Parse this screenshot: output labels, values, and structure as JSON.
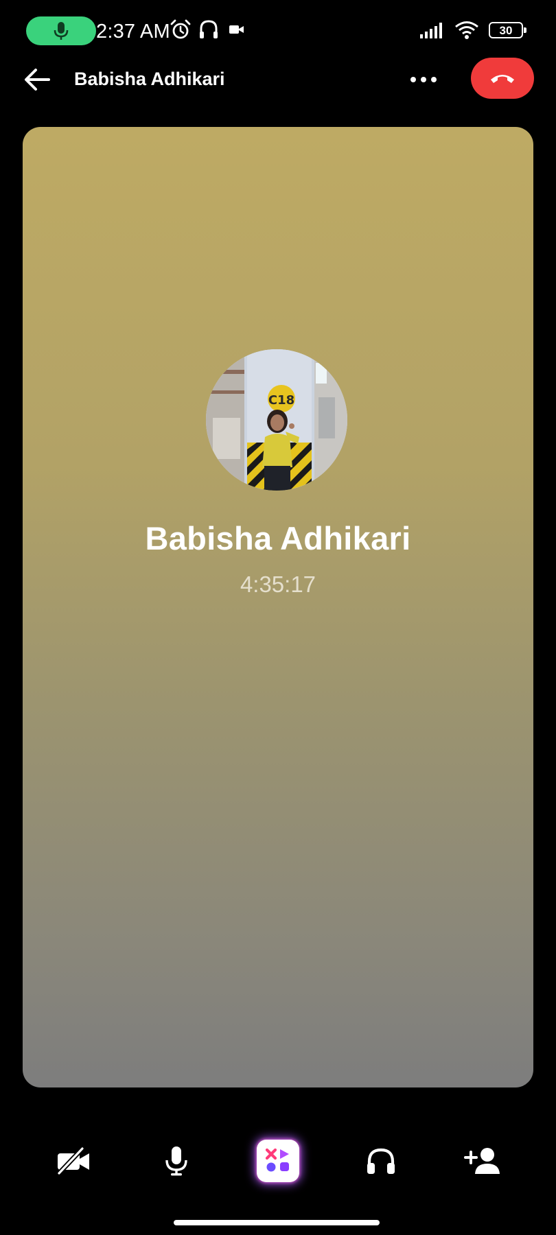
{
  "status_bar": {
    "time": "2:37 AM",
    "battery": "30",
    "icons": [
      "mic-active-icon",
      "alarm-icon",
      "headset-icon",
      "video-camera-icon",
      "signal-icon",
      "wifi-icon",
      "battery-icon"
    ]
  },
  "header": {
    "title": "Babisha Adhikari",
    "back_icon": "back-arrow-icon",
    "more_icon": "more-dots-icon",
    "end_call_icon": "end-call-icon"
  },
  "call": {
    "contact_name": "Babisha Adhikari",
    "duration": "4:35:17",
    "avatar_sign": "C18"
  },
  "controls": [
    {
      "name": "camera-off",
      "icon": "video-off-icon"
    },
    {
      "name": "microphone",
      "icon": "mic-icon"
    },
    {
      "name": "effects",
      "icon": "effects-icon"
    },
    {
      "name": "audio-output",
      "icon": "headphones-icon"
    },
    {
      "name": "add-person",
      "icon": "add-person-icon"
    }
  ],
  "colors": {
    "mic_pill": "#3ad27c",
    "end_call": "#f03b3b",
    "card_top": "#beaa64",
    "card_bottom": "#7d7d7d"
  }
}
